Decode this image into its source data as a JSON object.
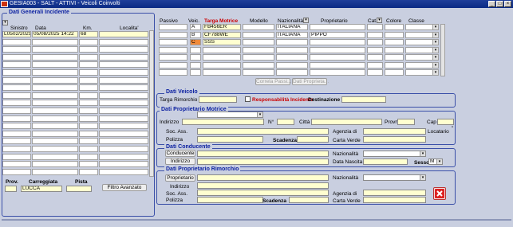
{
  "window": {
    "title": "GESIA003 - SALT - ATTIVI - Veicoli Coinvolti"
  },
  "incidents": {
    "title": "Dati Generali Incidente",
    "columns": {
      "sinistro": "Sinistro",
      "data": "Data",
      "km": "Km.",
      "localita": "Localita'"
    },
    "rows": [
      {
        "sinistro": "L0502/2025",
        "data": "05/08/2025 14:22",
        "km": "68",
        "localita": ""
      }
    ],
    "prov_label": "Prov.",
    "carreggiata_label": "Carreggiata",
    "carreggiata_value": "LUCCA",
    "pista_label": "Pista",
    "filtro_button": "Filtro Avanzato"
  },
  "vehicles": {
    "columns": {
      "passivo": "Passivo",
      "veic": "Veic.",
      "targa": "Targa Motrice",
      "modello": "Modello",
      "nazionalita": "Nazionalità",
      "proprietario": "Proprietario",
      "cat": "Cat.",
      "colore": "Colore",
      "classe": "Classe"
    },
    "rows": [
      {
        "veic": "A",
        "targa": "FB456ER",
        "nazionalita": "ITALIANA",
        "proprietario": ""
      },
      {
        "veic": "B",
        "targa": "CF788WE",
        "nazionalita": "ITALIANA",
        "proprietario": "PIPPO"
      },
      {
        "veic": "C",
        "targa": "SSS",
        "nazionalita": "",
        "proprietario": ""
      }
    ],
    "correla_button": "Correla Passi...",
    "dati_proprietario_button": "Dati Proprieta..."
  },
  "veicolo": {
    "title": "Dati Veicolo",
    "targa_rimorchio": "Targa Rimorchio",
    "responsabilita": "Responsabilità Incidente",
    "destinazione": "Destinazione"
  },
  "proprietario_motrice": {
    "title": "Dati Proprietario Motrice",
    "indirizzo": "Indirizzo",
    "numero": "N°",
    "citta": "Città",
    "provn": "Provn",
    "cap": "Cap",
    "soc_ass": "Soc. Ass.",
    "agenzia": "Agenzia di",
    "locatario": "Locatario",
    "polizza": "Polizza",
    "scadenza": "Scadenza",
    "carta_verde": "Carta Verde"
  },
  "conducente": {
    "title": "Dati Conducente",
    "conducente_button": "Conducente",
    "indirizzo_button": "Indirizzo",
    "nazionalita": "Nazionalità",
    "data_nascita": "Data Nascita",
    "sesso": "Sesso",
    "sesso_value": "M"
  },
  "proprietario_rimorchio": {
    "title": "Dati Proprietario Rimorchio",
    "proprietario_button": "Proprietario",
    "nazionalita": "Nazionalità",
    "indirizzo": "Indirizzo",
    "soc_ass": "Soc. Ass.",
    "agenzia": "Agenzia di",
    "polizza": "Polizza",
    "scadenza": "Scadenza",
    "carta_verde": "Carta Verde"
  }
}
